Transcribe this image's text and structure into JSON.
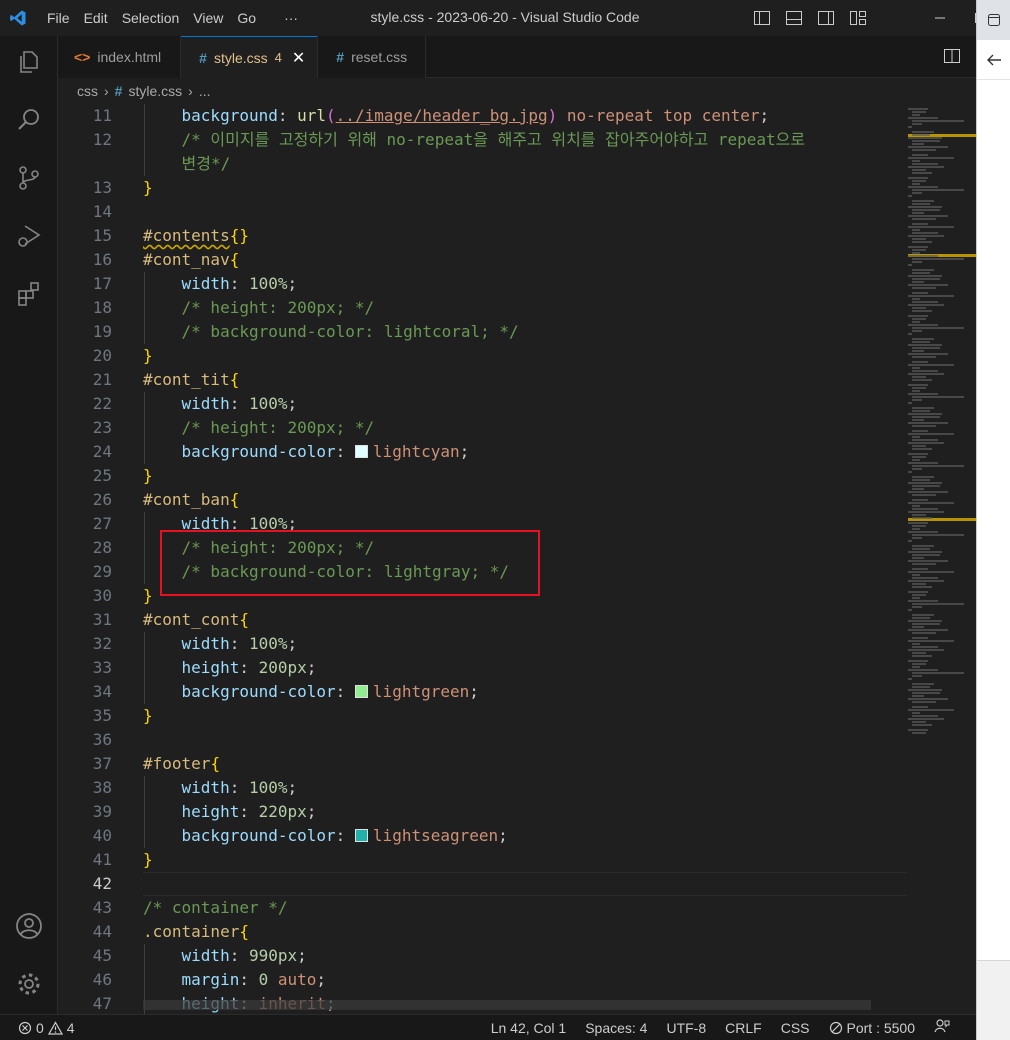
{
  "window": {
    "title": "style.css - 2023-06-20 - Visual Studio Code"
  },
  "menu": [
    "File",
    "Edit",
    "Selection",
    "View",
    "Go",
    "···"
  ],
  "tabs": [
    {
      "label": "index.html",
      "icon": "html-icon",
      "color": "#e37933",
      "active": false
    },
    {
      "label": "style.css",
      "icon": "css-icon",
      "color": "#519aba",
      "active": true,
      "badge": "4"
    },
    {
      "label": "reset.css",
      "icon": "css-icon",
      "color": "#519aba",
      "active": false
    }
  ],
  "breadcrumb": {
    "folder": "css",
    "file": "style.css",
    "more": "..."
  },
  "editor": {
    "current_line": "42",
    "lines": [
      {
        "n": "11",
        "seg": [
          [
            "    ",
            ""
          ],
          [
            "background",
            "t-prop"
          ],
          [
            ": ",
            "t-punc"
          ],
          [
            "url",
            "t-fn"
          ],
          [
            "(",
            "t-paren"
          ],
          [
            "../image/header_bg.jpg",
            "t-url"
          ],
          [
            ")",
            "t-paren"
          ],
          [
            " no-repeat top center",
            "t-val"
          ],
          [
            ";",
            "t-punc"
          ]
        ]
      },
      {
        "n": "12",
        "seg": [
          [
            "    ",
            ""
          ],
          [
            "/* 이미지를 고정하기 위해 no-repeat을 해주고 위치를 잡아주어야하고 repeat으로",
            "t-cmt"
          ]
        ]
      },
      {
        "n": "",
        "seg": [
          [
            "    ",
            ""
          ],
          [
            "변경*/",
            "t-cmt"
          ]
        ]
      },
      {
        "n": "13",
        "seg": [
          [
            "}",
            "t-brace"
          ]
        ]
      },
      {
        "n": "14",
        "seg": []
      },
      {
        "n": "15",
        "seg": [
          [
            "#contents",
            "t-sel squiggle"
          ],
          [
            "{}",
            "t-brace"
          ]
        ]
      },
      {
        "n": "16",
        "seg": [
          [
            "#cont_nav",
            "t-sel"
          ],
          [
            "{",
            "t-brace"
          ]
        ]
      },
      {
        "n": "17",
        "seg": [
          [
            "    ",
            ""
          ],
          [
            "width",
            "t-prop"
          ],
          [
            ": ",
            "t-punc"
          ],
          [
            "100%",
            "t-num"
          ],
          [
            ";",
            "t-punc"
          ]
        ]
      },
      {
        "n": "18",
        "seg": [
          [
            "    ",
            ""
          ],
          [
            "/* height: 200px; */",
            "t-cmt"
          ]
        ]
      },
      {
        "n": "19",
        "seg": [
          [
            "    ",
            ""
          ],
          [
            "/* background-color: lightcoral; */",
            "t-cmt"
          ]
        ]
      },
      {
        "n": "20",
        "seg": [
          [
            "}",
            "t-brace"
          ]
        ]
      },
      {
        "n": "21",
        "seg": [
          [
            "#cont_tit",
            "t-sel"
          ],
          [
            "{",
            "t-brace"
          ]
        ]
      },
      {
        "n": "22",
        "seg": [
          [
            "    ",
            ""
          ],
          [
            "width",
            "t-prop"
          ],
          [
            ": ",
            "t-punc"
          ],
          [
            "100%",
            "t-num"
          ],
          [
            ";",
            "t-punc"
          ]
        ]
      },
      {
        "n": "23",
        "seg": [
          [
            "    ",
            ""
          ],
          [
            "/* height: 200px; */",
            "t-cmt"
          ]
        ]
      },
      {
        "n": "24",
        "seg": [
          [
            "    ",
            ""
          ],
          [
            "background-color",
            "t-prop"
          ],
          [
            ": ",
            "t-punc"
          ],
          [
            "#e0ffff",
            "swatch"
          ],
          [
            "lightcyan",
            "t-val"
          ],
          [
            ";",
            "t-punc"
          ]
        ]
      },
      {
        "n": "25",
        "seg": [
          [
            "}",
            "t-brace"
          ]
        ]
      },
      {
        "n": "26",
        "seg": [
          [
            "#cont_ban",
            "t-sel"
          ],
          [
            "{",
            "t-brace"
          ]
        ]
      },
      {
        "n": "27",
        "seg": [
          [
            "    ",
            ""
          ],
          [
            "width",
            "t-prop"
          ],
          [
            ": ",
            "t-punc"
          ],
          [
            "100%",
            "t-num"
          ],
          [
            ";",
            "t-punc"
          ]
        ]
      },
      {
        "n": "28",
        "seg": [
          [
            "    ",
            ""
          ],
          [
            "/* height: 200px; */",
            "t-cmt"
          ]
        ]
      },
      {
        "n": "29",
        "seg": [
          [
            "    ",
            ""
          ],
          [
            "/* background-color: lightgray; */",
            "t-cmt"
          ]
        ]
      },
      {
        "n": "30",
        "seg": [
          [
            "}",
            "t-brace"
          ]
        ]
      },
      {
        "n": "31",
        "seg": [
          [
            "#cont_cont",
            "t-sel"
          ],
          [
            "{",
            "t-brace"
          ]
        ]
      },
      {
        "n": "32",
        "seg": [
          [
            "    ",
            ""
          ],
          [
            "width",
            "t-prop"
          ],
          [
            ": ",
            "t-punc"
          ],
          [
            "100%",
            "t-num"
          ],
          [
            ";",
            "t-punc"
          ]
        ]
      },
      {
        "n": "33",
        "seg": [
          [
            "    ",
            ""
          ],
          [
            "height",
            "t-prop"
          ],
          [
            ": ",
            "t-punc"
          ],
          [
            "200px",
            "t-num"
          ],
          [
            ";",
            "t-punc"
          ]
        ]
      },
      {
        "n": "34",
        "seg": [
          [
            "    ",
            ""
          ],
          [
            "background-color",
            "t-prop"
          ],
          [
            ": ",
            "t-punc"
          ],
          [
            "#90ee90",
            "swatch"
          ],
          [
            "lightgreen",
            "t-val"
          ],
          [
            ";",
            "t-punc"
          ]
        ]
      },
      {
        "n": "35",
        "seg": [
          [
            "}",
            "t-brace"
          ]
        ]
      },
      {
        "n": "36",
        "seg": []
      },
      {
        "n": "37",
        "seg": [
          [
            "#footer",
            "t-sel"
          ],
          [
            "{",
            "t-brace"
          ]
        ]
      },
      {
        "n": "38",
        "seg": [
          [
            "    ",
            ""
          ],
          [
            "width",
            "t-prop"
          ],
          [
            ": ",
            "t-punc"
          ],
          [
            "100%",
            "t-num"
          ],
          [
            ";",
            "t-punc"
          ]
        ]
      },
      {
        "n": "39",
        "seg": [
          [
            "    ",
            ""
          ],
          [
            "height",
            "t-prop"
          ],
          [
            ": ",
            "t-punc"
          ],
          [
            "220px",
            "t-num"
          ],
          [
            ";",
            "t-punc"
          ]
        ]
      },
      {
        "n": "40",
        "seg": [
          [
            "    ",
            ""
          ],
          [
            "background-color",
            "t-prop"
          ],
          [
            ": ",
            "t-punc"
          ],
          [
            "#20b2aa",
            "swatch"
          ],
          [
            "lightseagreen",
            "t-val"
          ],
          [
            ";",
            "t-punc"
          ]
        ]
      },
      {
        "n": "41",
        "seg": [
          [
            "}",
            "t-brace"
          ]
        ]
      },
      {
        "n": "42",
        "seg": []
      },
      {
        "n": "43",
        "seg": [
          [
            "/* container */",
            "t-cmt"
          ]
        ]
      },
      {
        "n": "44",
        "seg": [
          [
            ".container",
            "t-sel"
          ],
          [
            "{",
            "t-brace"
          ]
        ]
      },
      {
        "n": "45",
        "seg": [
          [
            "    ",
            ""
          ],
          [
            "width",
            "t-prop"
          ],
          [
            ": ",
            "t-punc"
          ],
          [
            "990px",
            "t-num"
          ],
          [
            ";",
            "t-punc"
          ]
        ]
      },
      {
        "n": "46",
        "seg": [
          [
            "    ",
            ""
          ],
          [
            "margin",
            "t-prop"
          ],
          [
            ": ",
            "t-punc"
          ],
          [
            "0",
            "t-num"
          ],
          [
            " auto",
            "t-val"
          ],
          [
            ";",
            "t-punc"
          ]
        ]
      },
      {
        "n": "47",
        "seg": [
          [
            "    ",
            ""
          ],
          [
            "height",
            "t-prop"
          ],
          [
            ": ",
            "t-punc"
          ],
          [
            "inherit",
            "t-val"
          ],
          [
            ";",
            "t-punc"
          ]
        ]
      }
    ]
  },
  "status": {
    "errors": "0",
    "warnings": "4",
    "position": "Ln 42, Col 1",
    "spaces": "Spaces: 4",
    "encoding": "UTF-8",
    "eol": "CRLF",
    "language": "CSS",
    "port": "Port : 5500"
  },
  "colors": {
    "accent": "#0078d4",
    "highlight_box": "#e81123",
    "modified_tab": "#e2c08d"
  }
}
